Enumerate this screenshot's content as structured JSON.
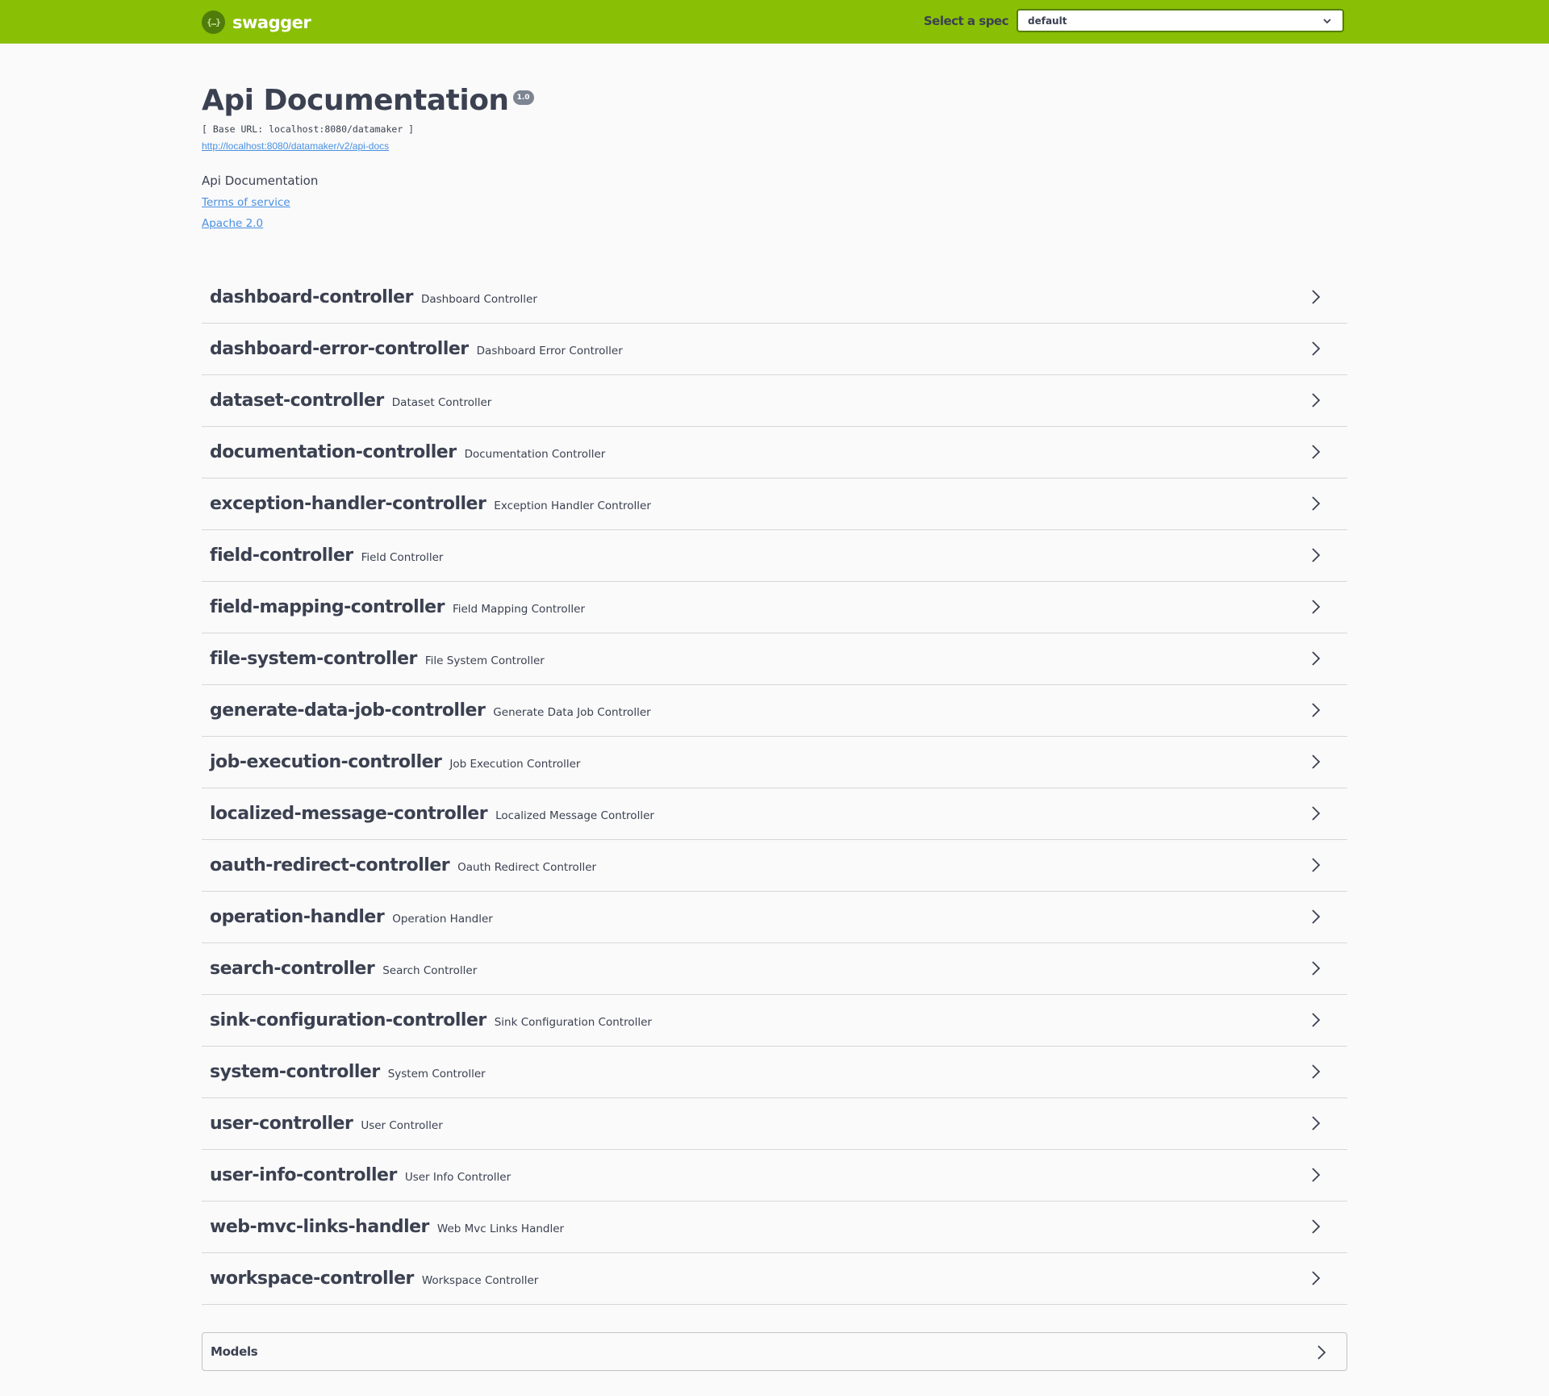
{
  "topbar": {
    "brand_glyph": "{…}",
    "brand": "swagger",
    "spec_label": "Select a spec",
    "spec_selected": "default",
    "colors": {
      "background": "#89bf04",
      "select_border": "#547f00"
    }
  },
  "info": {
    "title": "Api Documentation",
    "version": "1.0",
    "base_url": "[ Base URL: localhost:8080/datamaker ]",
    "api_docs_url": "http://localhost:8080/datamaker/v2/api-docs",
    "description": "Api Documentation",
    "terms_link": "Terms of service",
    "license_link": "Apache 2.0"
  },
  "tags": [
    {
      "name": "dashboard-controller",
      "description": "Dashboard Controller"
    },
    {
      "name": "dashboard-error-controller",
      "description": "Dashboard Error Controller"
    },
    {
      "name": "dataset-controller",
      "description": "Dataset Controller"
    },
    {
      "name": "documentation-controller",
      "description": "Documentation Controller"
    },
    {
      "name": "exception-handler-controller",
      "description": "Exception Handler Controller"
    },
    {
      "name": "field-controller",
      "description": "Field Controller"
    },
    {
      "name": "field-mapping-controller",
      "description": "Field Mapping Controller"
    },
    {
      "name": "file-system-controller",
      "description": "File System Controller"
    },
    {
      "name": "generate-data-job-controller",
      "description": "Generate Data Job Controller"
    },
    {
      "name": "job-execution-controller",
      "description": "Job Execution Controller"
    },
    {
      "name": "localized-message-controller",
      "description": "Localized Message Controller"
    },
    {
      "name": "oauth-redirect-controller",
      "description": "Oauth Redirect Controller"
    },
    {
      "name": "operation-handler",
      "description": "Operation Handler"
    },
    {
      "name": "search-controller",
      "description": "Search Controller"
    },
    {
      "name": "sink-configuration-controller",
      "description": "Sink Configuration Controller"
    },
    {
      "name": "system-controller",
      "description": "System Controller"
    },
    {
      "name": "user-controller",
      "description": "User Controller"
    },
    {
      "name": "user-info-controller",
      "description": "User Info Controller"
    },
    {
      "name": "web-mvc-links-handler",
      "description": "Web Mvc Links Handler"
    },
    {
      "name": "workspace-controller",
      "description": "Workspace Controller"
    }
  ],
  "models": {
    "title": "Models"
  },
  "icons": {
    "logo": "swagger-logo-icon",
    "select_chevron": "chevron-down-icon",
    "row_chevron": "chevron-right-icon"
  }
}
